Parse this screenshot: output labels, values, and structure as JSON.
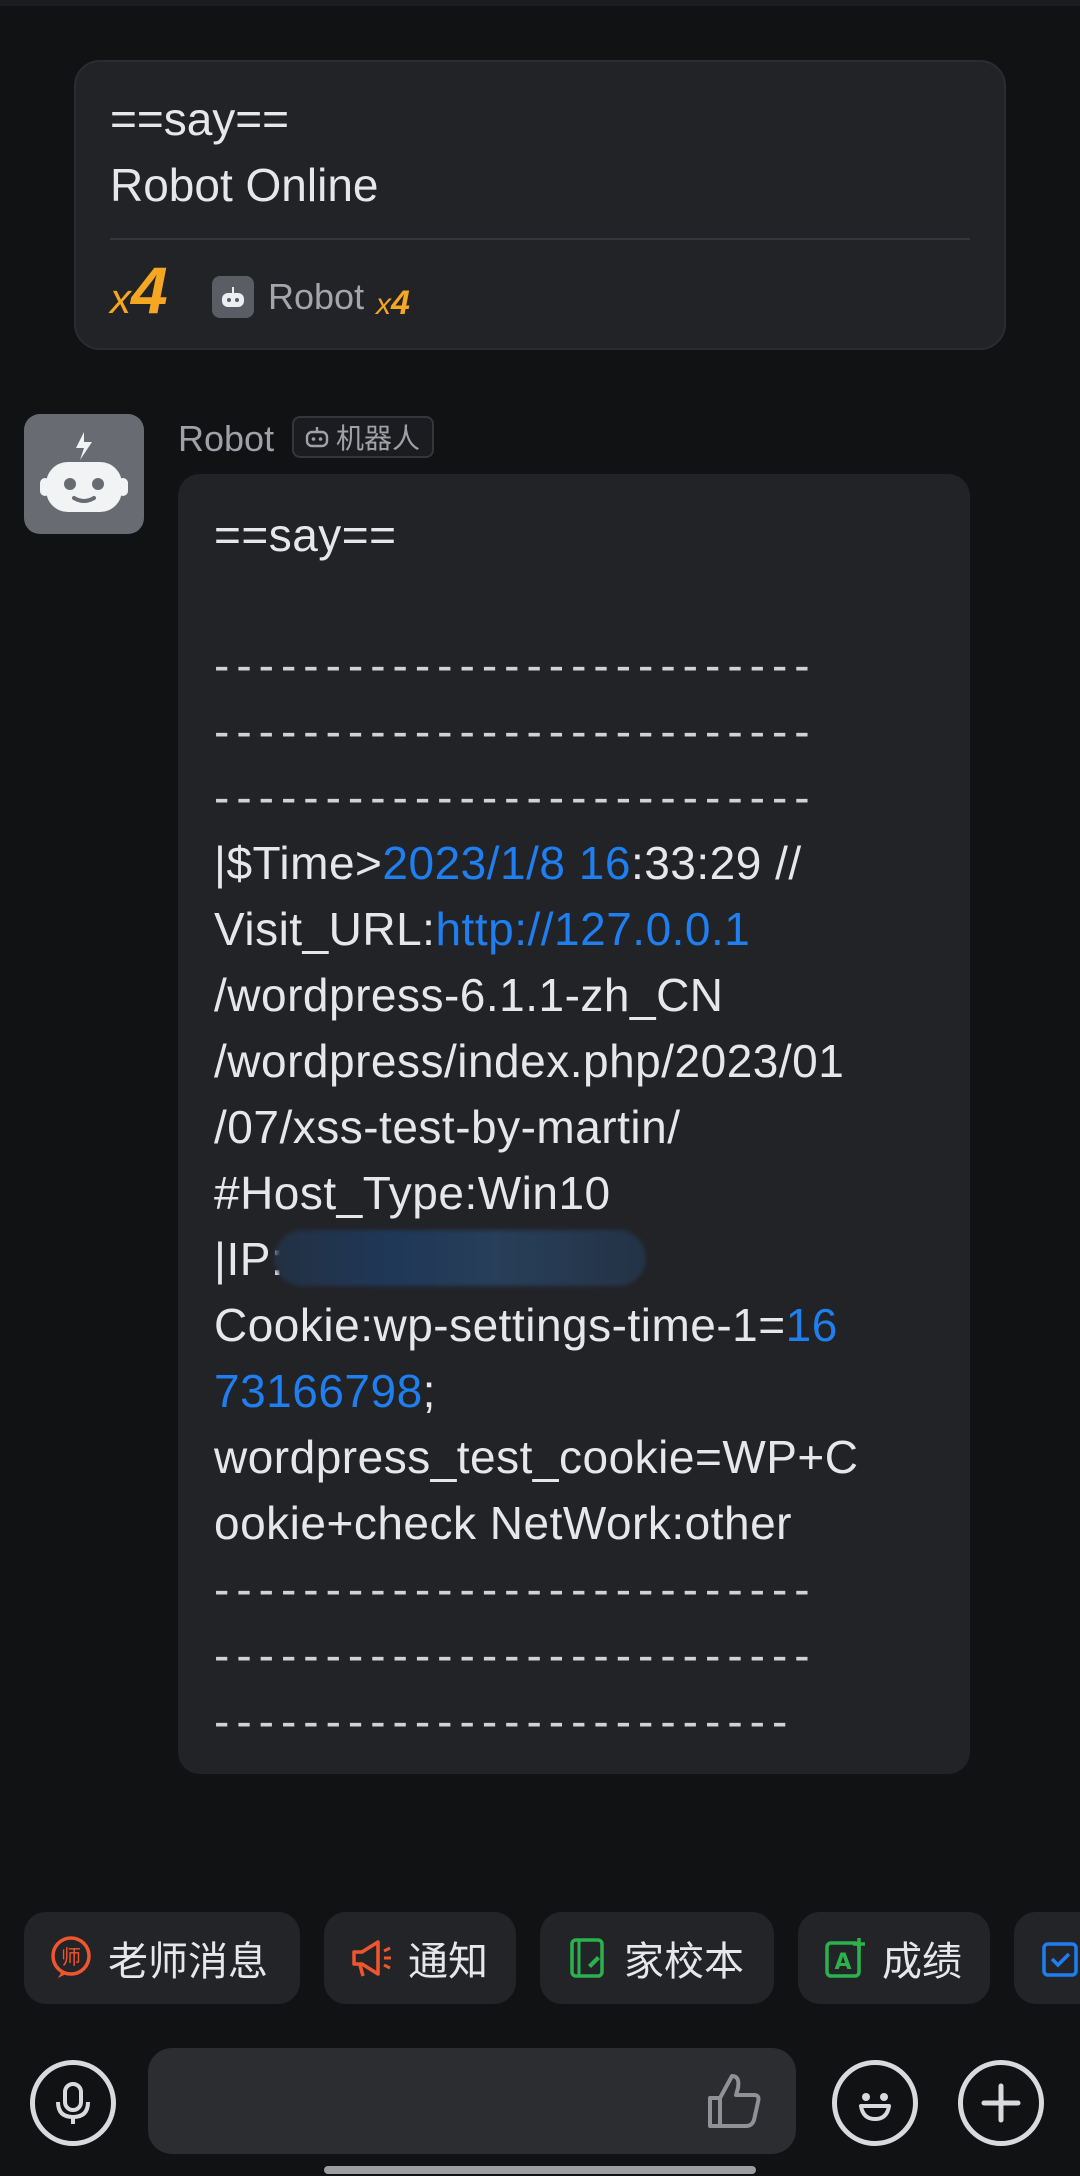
{
  "combined_card": {
    "line1": "==say==",
    "line2": "Robot Online",
    "count_x": "x",
    "count_n": "4",
    "sender": "Robot",
    "sender_count_x": "x",
    "sender_count_n": "4"
  },
  "message": {
    "sender": "Robot",
    "badge": "机器人",
    "lines": {
      "l1": "==say==",
      "d1": "---------------------------",
      "d2": "---------------------------",
      "d3": "---------------------------",
      "time_prefix": "|$Time>",
      "time_link": "2023/1/8 16",
      "time_suffix": ":33:29 //",
      "visit_prefix": "Visit_URL:",
      "visit_link1": "http://127.0.0.1",
      "visit_link2": "/wordpress-6.1.1-zh_CN",
      "visit_link3": "/wordpress/index.php/2023/01",
      "visit_link4": "/07/xss-test-by-martin/",
      "host": "#Host_Type:Win10",
      "ip": "|IP:",
      "cookie_prefix": "Cookie:wp-settings-time-1=",
      "cookie_link1": "16",
      "cookie_link2": "73166798",
      "cookie_semicolon": ";",
      "cookie2": "wordpress_test_cookie=WP+C",
      "cookie3": "ookie+check NetWork:other",
      "d4": "---------------------------",
      "d5": "---------------------------",
      "d6": "--------------------------"
    }
  },
  "quick_actions": [
    {
      "label": "老师消息",
      "icon": "teacher-icon",
      "color": "#f0562d"
    },
    {
      "label": "通知",
      "icon": "megaphone-icon",
      "color": "#f0562d"
    },
    {
      "label": "家校本",
      "icon": "notebook-icon",
      "color": "#2bb24c"
    },
    {
      "label": "成绩",
      "icon": "grade-icon",
      "color": "#2bb24c"
    }
  ],
  "input_bar": {
    "voice_icon": "microphone-icon",
    "like_icon": "thumbs-up-icon",
    "emoji_icon": "emoji-icon",
    "plus_icon": "plus-icon"
  },
  "colors": {
    "link": "#1f7ef0",
    "accent_orange": "#f5a623",
    "background": "#111214",
    "bubble": "#222327"
  }
}
